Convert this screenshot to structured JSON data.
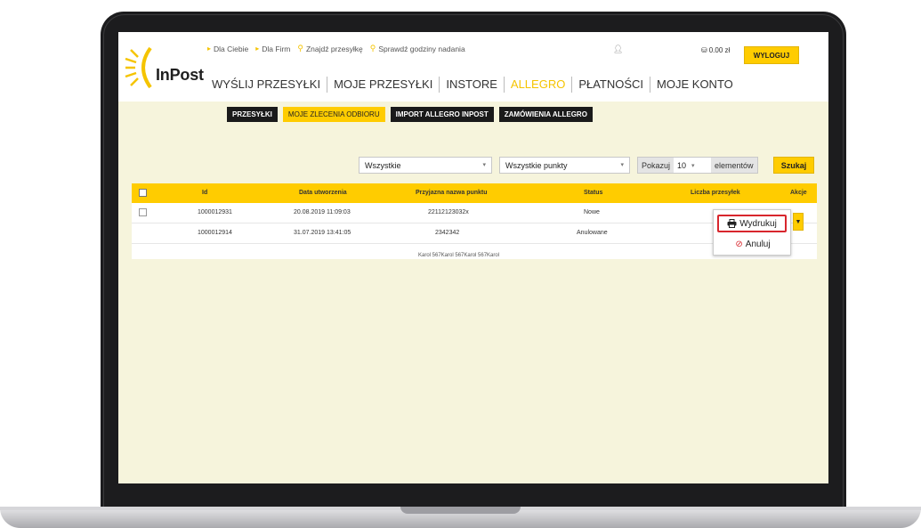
{
  "header": {
    "logo_text": "InPost",
    "top_links": [
      {
        "label": "Dla Ciebie"
      },
      {
        "label": "Dla Firm"
      },
      {
        "label": "Znajdź przesyłkę"
      },
      {
        "label": "Sprawdź godziny nadania"
      }
    ],
    "balance": "0.00 zł",
    "logout_label": "WYLOGUJ",
    "nav": [
      {
        "label": "WYŚLIJ PRZESYŁKI"
      },
      {
        "label": "MOJE PRZESYŁKI"
      },
      {
        "label": "INSTORE"
      },
      {
        "label": "ALLEGRO"
      },
      {
        "label": "PŁATNOŚCI"
      },
      {
        "label": "MOJE KONTO"
      }
    ]
  },
  "subtabs": [
    {
      "label": "PRZESYŁKI"
    },
    {
      "label": "MOJE ZLECENIA ODBIORU"
    },
    {
      "label": "IMPORT ALLEGRO INPOST"
    },
    {
      "label": "ZAMÓWIENIA ALLEGRO"
    }
  ],
  "filters": {
    "status_select": "Wszystkie",
    "point_select": "Wszystkie punkty",
    "show_label": "Pokazuj",
    "page_size": "10",
    "elements_label": "elementów",
    "search_label": "Szukaj"
  },
  "table": {
    "columns": [
      "Id",
      "Data utworzenia",
      "Przyjazna nazwa punktu",
      "Status",
      "Liczba przesyłek",
      "Akcje"
    ],
    "rows": [
      {
        "id": "1000012931",
        "date": "20.08.2019 11:09:03",
        "point": "22112123032x",
        "status": "Nowe"
      },
      {
        "id": "1000012914",
        "date": "31.07.2019 13:41:05",
        "point": "2342342",
        "status": "Anulowane"
      }
    ],
    "overflow_text": "Karol 567Karol 567Karol 567Karol"
  },
  "action_menu": {
    "print_label": "Wydrukuj",
    "cancel_label": "Anuluj"
  },
  "colors": {
    "accent": "#ffcc00",
    "screen_bg": "#f6f4dc",
    "highlight": "#d8262d"
  }
}
